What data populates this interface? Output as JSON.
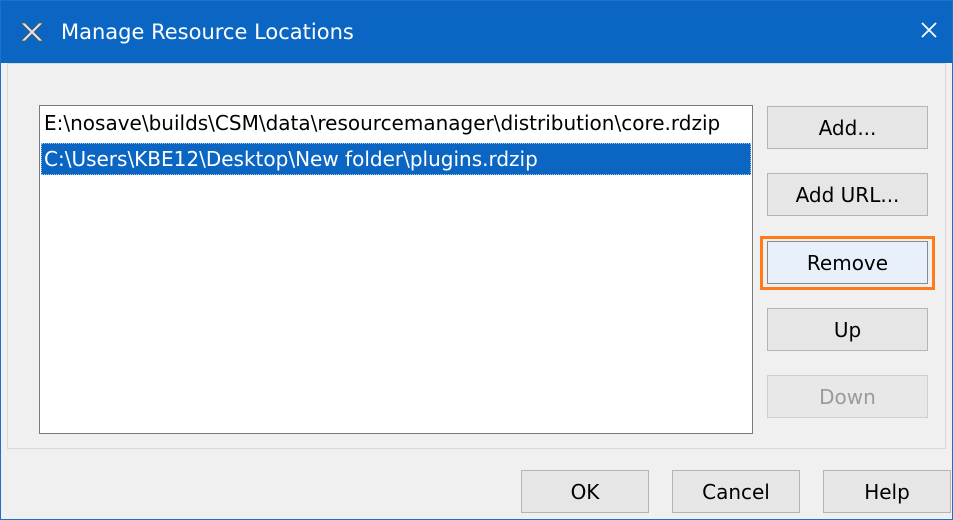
{
  "window": {
    "title": "Manage Resource Locations",
    "icon": "magicdraw-app-icon",
    "close_icon": "close-icon"
  },
  "locations": {
    "items": [
      {
        "label": "E:\\nosave\\builds\\CSM\\data\\resourcemanager\\distribution\\core.rdzip",
        "selected": false
      },
      {
        "label": "C:\\Users\\KBE12\\Desktop\\New folder\\plugins.rdzip",
        "selected": true
      }
    ]
  },
  "side_buttons": {
    "add": "Add...",
    "add_url": "Add URL...",
    "remove": "Remove",
    "up": "Up",
    "down": "Down"
  },
  "dialog_buttons": {
    "ok": "OK",
    "cancel": "Cancel",
    "help": "Help"
  },
  "colors": {
    "titlebar": "#0a66c2",
    "selection": "#0a66c2",
    "highlight": "#ff7a1a"
  }
}
